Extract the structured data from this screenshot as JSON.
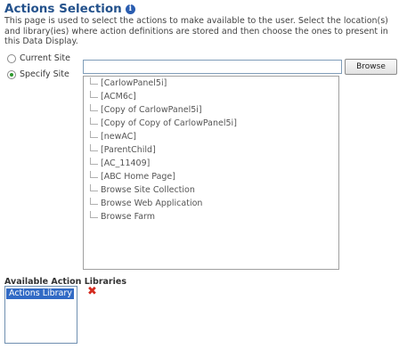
{
  "header": {
    "title": "Actions Selection",
    "description": "This page is used to select the actions to make available to the user. Select the location(s) and library(ies) where action definitions are stored and then choose the ones to present in this Data Display."
  },
  "site_options": {
    "current_site_label": "Current Site",
    "specify_site_label": "Specify Site",
    "selected": "Specify Site"
  },
  "site_input": {
    "value": ""
  },
  "browse_label": "Browse",
  "tree_items": [
    "[CarlowPanel5i]",
    "[ACM6c]",
    "[Copy of CarlowPanel5i]",
    "[Copy of Copy of CarlowPanel5i]",
    "[newAC]",
    "[ParentChild]",
    "[AC_11409]",
    "[ABC Home Page]",
    "Browse Site Collection",
    "Browse Web Application",
    "Browse Farm"
  ],
  "libraries": {
    "label": "Available Action Libraries",
    "items": [
      "Actions Library"
    ],
    "selected": "Actions Library"
  },
  "colors": {
    "title": "#24528c",
    "selection": "#316ac5",
    "delete": "#d42a1e",
    "radio_checked": "#2e9a2e"
  },
  "icons": {
    "info": "info-icon",
    "delete": "delete-x-icon"
  }
}
